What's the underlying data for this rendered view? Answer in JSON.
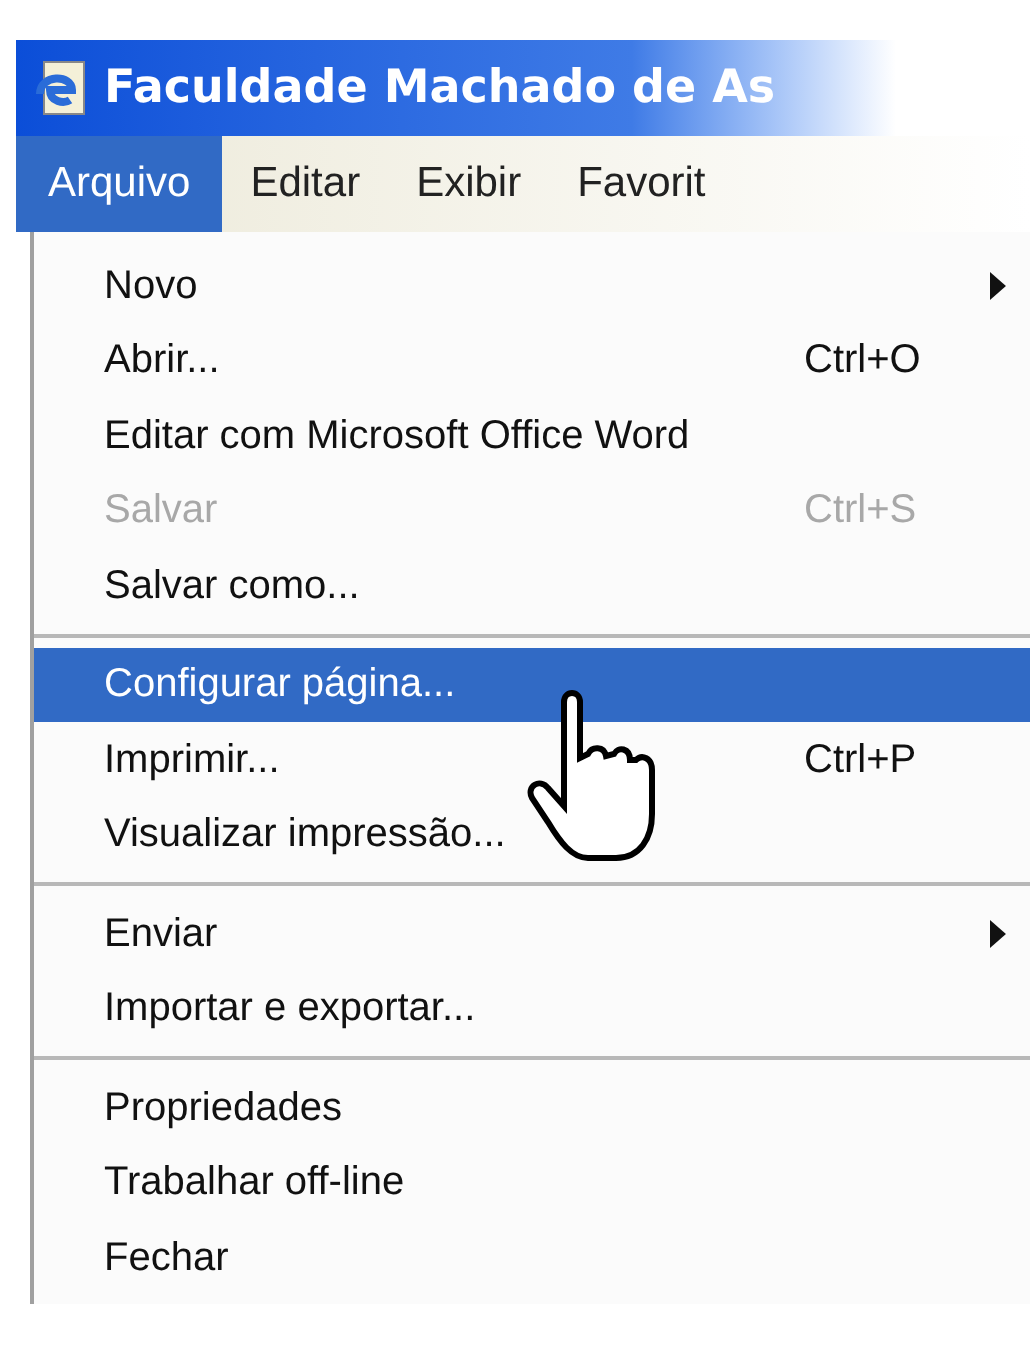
{
  "window": {
    "title": "Faculdade Machado de As"
  },
  "menu_bar": [
    {
      "label": "Arquivo",
      "selected": true
    },
    {
      "label": "Editar",
      "selected": false
    },
    {
      "label": "Exibir",
      "selected": false
    },
    {
      "label": "Favorit",
      "selected": false
    }
  ],
  "menu": [
    {
      "kind": "item",
      "label": "Novo",
      "submenu": true,
      "disabled": false,
      "selected": false
    },
    {
      "kind": "item",
      "label": "Abrir...",
      "shortcut": "Ctrl+O",
      "submenu": false,
      "disabled": false,
      "selected": false
    },
    {
      "kind": "item",
      "label": "Editar com Microsoft Office Word",
      "submenu": false,
      "disabled": false,
      "selected": false
    },
    {
      "kind": "item",
      "label": "Salvar",
      "shortcut": "Ctrl+S",
      "submenu": false,
      "disabled": true,
      "selected": false
    },
    {
      "kind": "item",
      "label": "Salvar como...",
      "submenu": false,
      "disabled": false,
      "selected": false
    },
    {
      "kind": "separator"
    },
    {
      "kind": "item",
      "label": "Configurar página...",
      "submenu": false,
      "disabled": false,
      "selected": true
    },
    {
      "kind": "item",
      "label": "Imprimir...",
      "shortcut": "Ctrl+P",
      "submenu": false,
      "disabled": false,
      "selected": false
    },
    {
      "kind": "item",
      "label": "Visualizar impressão...",
      "submenu": false,
      "disabled": false,
      "selected": false
    },
    {
      "kind": "separator"
    },
    {
      "kind": "item",
      "label": "Enviar",
      "submenu": true,
      "disabled": false,
      "selected": false
    },
    {
      "kind": "item",
      "label": "Importar e exportar...",
      "submenu": false,
      "disabled": false,
      "selected": false
    },
    {
      "kind": "separator"
    },
    {
      "kind": "item",
      "label": "Propriedades",
      "submenu": false,
      "disabled": false,
      "selected": false
    },
    {
      "kind": "item",
      "label": "Trabalhar off-line",
      "submenu": false,
      "disabled": false,
      "selected": false
    },
    {
      "kind": "item",
      "label": "Fechar",
      "submenu": false,
      "disabled": false,
      "selected": false
    }
  ]
}
